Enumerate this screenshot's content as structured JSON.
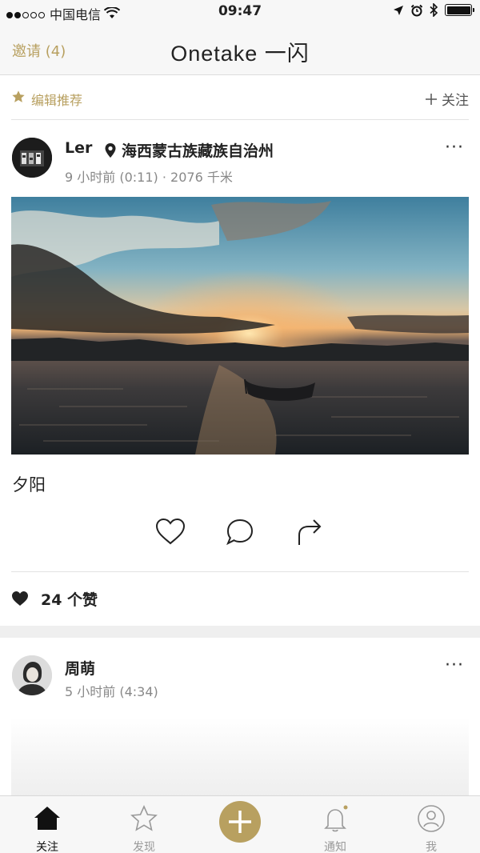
{
  "status_bar": {
    "carrier": "中国电信",
    "time": "09:47",
    "battery_level": 1.0
  },
  "navbar": {
    "invite_label": "邀请 (4)",
    "title": "Onetake 一闪"
  },
  "section": {
    "label": "编辑推荐",
    "follow_label": "关注"
  },
  "post1": {
    "username": "Ler",
    "location": "海西蒙古族藏族自治州",
    "meta": "9 小时前 (0:11) · 2076 千米",
    "more": "···",
    "caption": "夕阳",
    "likes": "24 个赞"
  },
  "post2": {
    "username": "周萌",
    "meta": "5 小时前 (4:34)",
    "more": "···"
  },
  "tabbar": {
    "tabs": [
      {
        "label": "关注",
        "icon": "home-icon"
      },
      {
        "label": "发现",
        "icon": "star-icon"
      },
      {
        "label": "",
        "icon": "plus-icon"
      },
      {
        "label": "通知",
        "icon": "bell-icon"
      },
      {
        "label": "我",
        "icon": "profile-icon"
      }
    ]
  },
  "colors": {
    "accent": "#b8a060",
    "background": "#ffffff",
    "bar": "#f7f7f7"
  }
}
